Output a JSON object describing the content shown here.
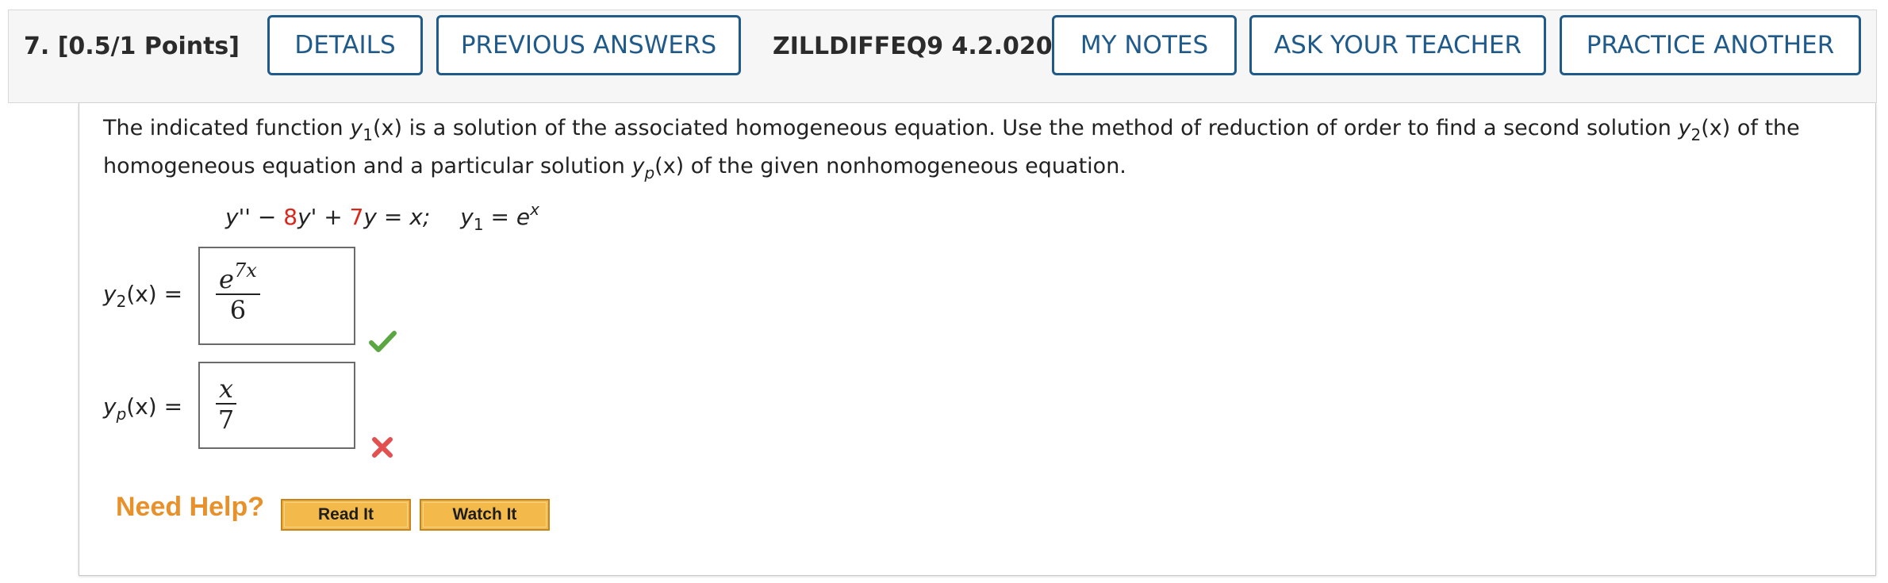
{
  "question": {
    "number_points": "7.  [0.5/1 Points]",
    "reference": "ZILLDIFFEQ9 4.2.020."
  },
  "header_buttons": {
    "details": "DETAILS",
    "previous_answers": "PREVIOUS ANSWERS",
    "my_notes": "MY NOTES",
    "ask_teacher": "ASK YOUR TEACHER",
    "practice_another": "PRACTICE ANOTHER"
  },
  "prompt": {
    "part1": "The indicated function ",
    "y1_var": "y",
    "y1_sub": "1",
    "y1_arg": "(x)",
    "part2": " is a solution of the associated homogeneous equation. Use the method of reduction of order to find a second solution ",
    "y2_var": "y",
    "y2_sub": "2",
    "y2_arg": "(x)",
    "part3": " of the homogeneous equation and a particular solution ",
    "yp_var": "y",
    "yp_sub": "p",
    "yp_arg": "(x)",
    "part4": " of the given nonhomogeneous equation."
  },
  "equation": {
    "lhs_start": "y'' − ",
    "coef1": "8",
    "mid1": "y' + ",
    "coef2": "7",
    "mid2": "y = x;",
    "y1_var": "y",
    "y1_sub": "1",
    "equals": " = e",
    "exp": "x"
  },
  "answers": {
    "y2_label_var": "y",
    "y2_label_sub": "2",
    "y2_label_rest": "(x)  =",
    "y2_num_base": "e",
    "y2_num_exp": "7x",
    "y2_den": "6",
    "y2_status": "correct",
    "yp_label_var": "y",
    "yp_label_sub": "p",
    "yp_label_rest": "(x)  =",
    "yp_num": "x",
    "yp_den": "7",
    "yp_status": "incorrect"
  },
  "help": {
    "label": "Need Help?",
    "read_it": "Read It",
    "watch_it": "Watch It"
  },
  "colors": {
    "accent_blue": "#1f5a8a",
    "coefficient_red": "#d9271c",
    "correct_green": "#5aa640",
    "incorrect_red": "#e35050",
    "help_orange": "#e8902a"
  }
}
